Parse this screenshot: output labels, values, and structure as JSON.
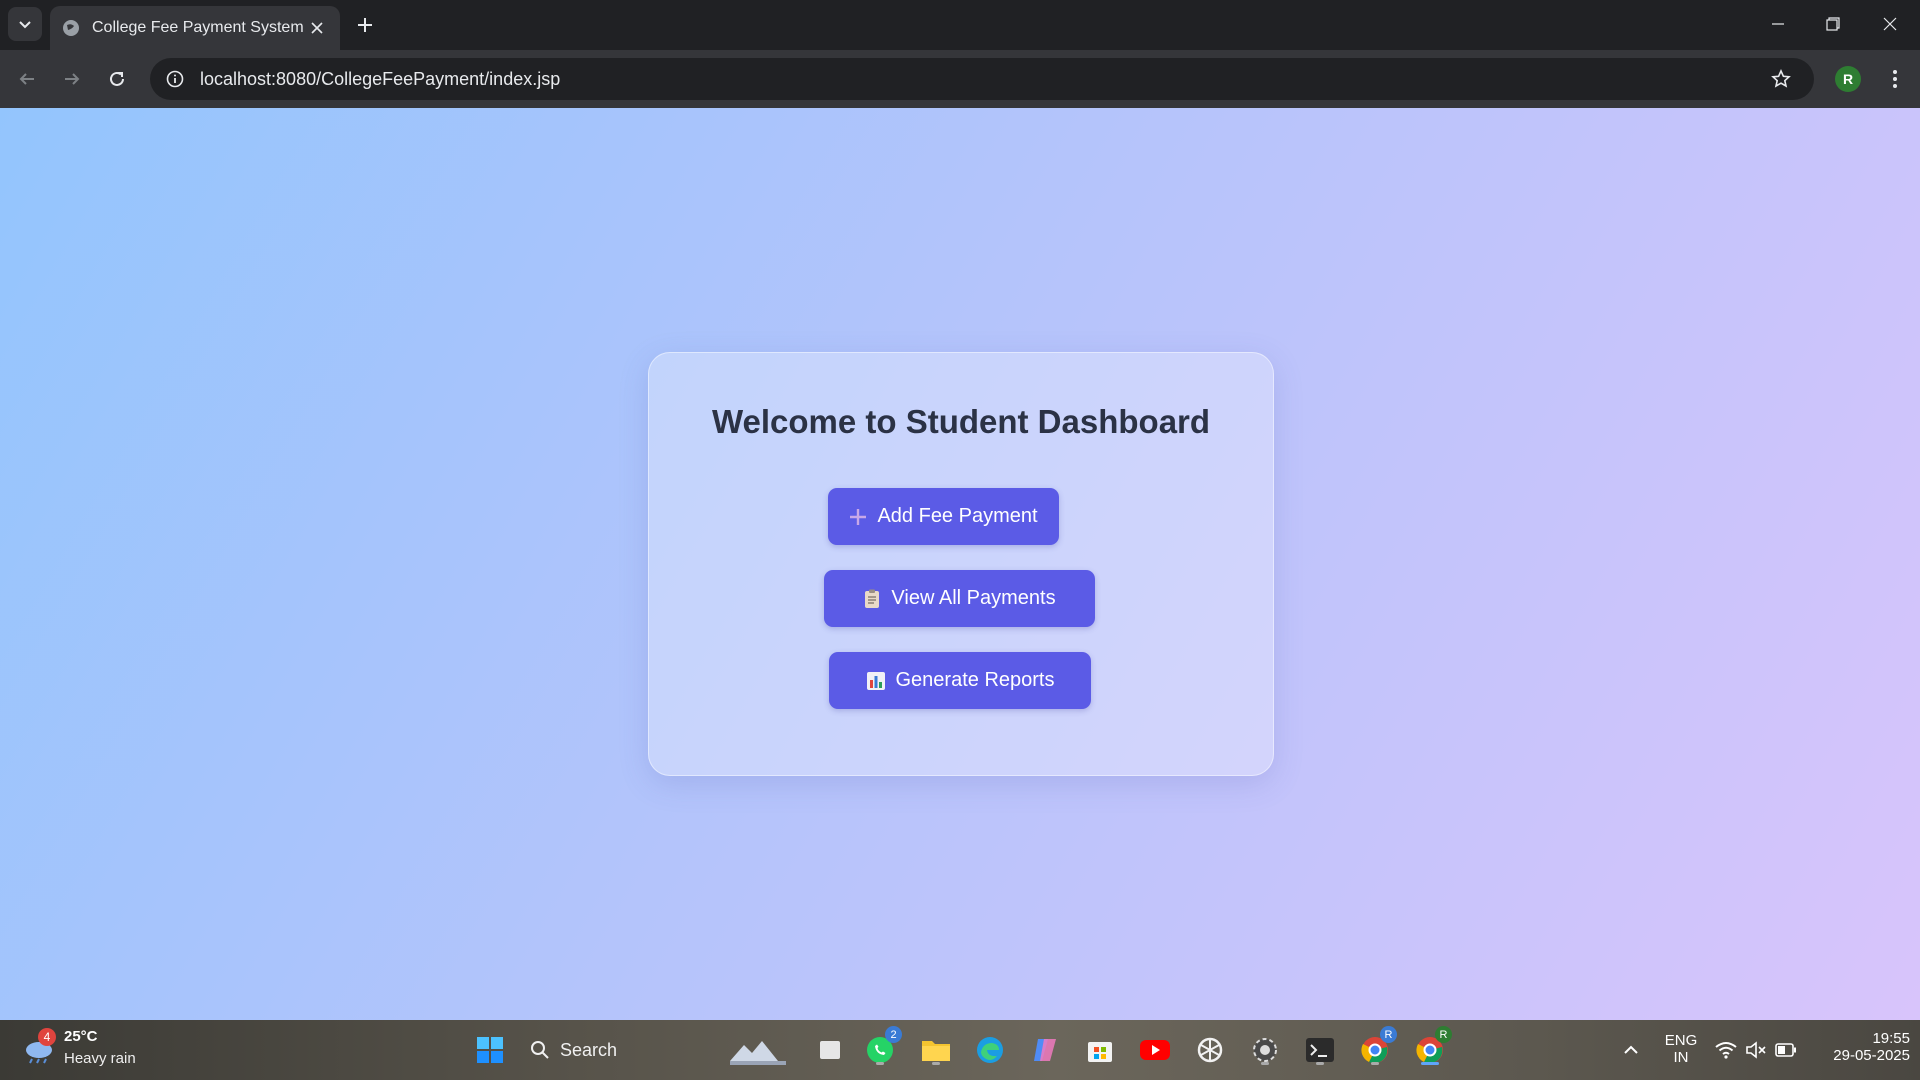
{
  "browser": {
    "tab_title": "College Fee Payment System",
    "url": "localhost:8080/CollegeFeePayment/index.jsp",
    "profile_initial": "R"
  },
  "page": {
    "heading": "Welcome to Student Dashboard",
    "buttons": [
      {
        "label": "Add Fee Payment",
        "icon": "plus-icon"
      },
      {
        "label": "View All Payments",
        "icon": "clipboard-icon"
      },
      {
        "label": "Generate Reports",
        "icon": "bar-chart-icon"
      }
    ],
    "colors": {
      "button_bg": "#5b5be6",
      "heading": "#2b3245"
    }
  },
  "taskbar": {
    "weather": {
      "temp": "25°C",
      "condition": "Heavy rain",
      "badge": "4"
    },
    "search_label": "Search",
    "whatsapp_badge": "2",
    "language": "ENG",
    "region": "IN",
    "time": "19:55",
    "date": "29-05-2025"
  }
}
